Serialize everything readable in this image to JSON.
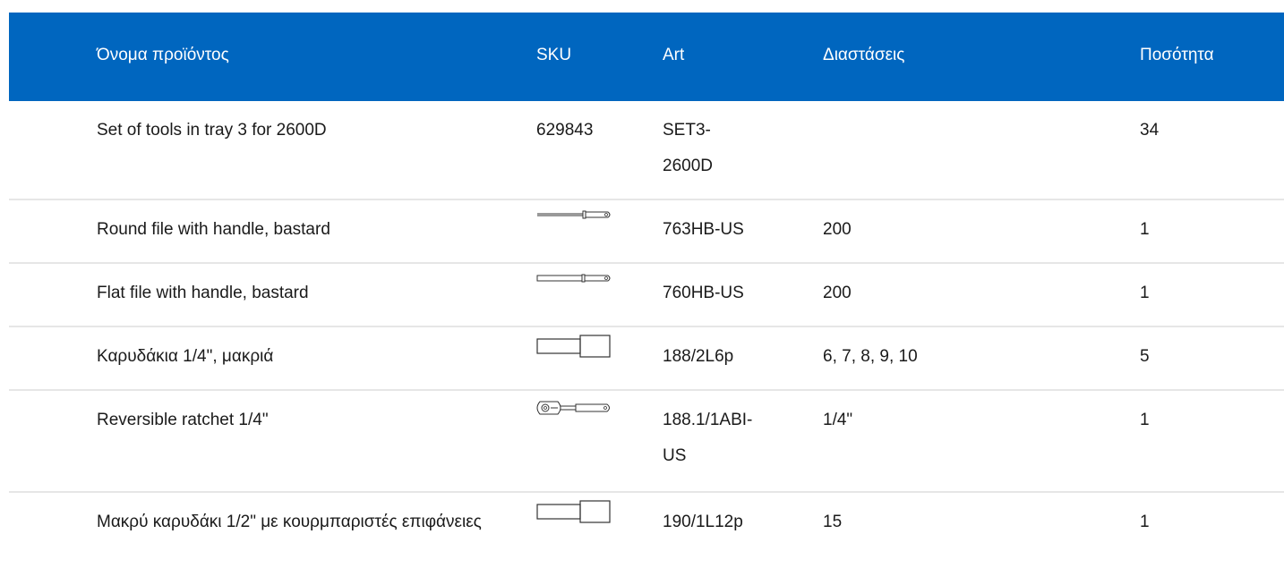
{
  "table": {
    "headers": {
      "name": "Όνομα προϊόντος",
      "sku": "SKU",
      "art": "Art",
      "dimensions": "Διαστάσεις",
      "quantity": "Ποσότητα"
    },
    "rows": [
      {
        "name": "Set of tools in tray 3 for 2600D",
        "sku": "629843",
        "art": "SET3-2600D",
        "dimensions": "",
        "quantity": "34",
        "icon": "none"
      },
      {
        "name": "Round file with handle, bastard",
        "sku": "",
        "art": "763HB-US",
        "dimensions": "200",
        "quantity": "1",
        "icon": "round-file-icon"
      },
      {
        "name": "Flat file with handle, bastard",
        "sku": "",
        "art": "760HB-US",
        "dimensions": "200",
        "quantity": "1",
        "icon": "flat-file-icon"
      },
      {
        "name": "Καρυδάκια 1/4\", μακριά",
        "sku": "",
        "art": "188/2L6p",
        "dimensions": "6, 7, 8, 9, 10",
        "quantity": "5",
        "icon": "socket-icon"
      },
      {
        "name": "Reversible ratchet 1/4\"",
        "sku": "",
        "art": "188.1/1ABI-US",
        "dimensions": "1/4\"",
        "quantity": "1",
        "icon": "ratchet-icon"
      },
      {
        "name": "Μακρύ καρυδάκι 1/2\" με κουρμπαριστές επιφάνειες",
        "sku": "",
        "art": "190/1L12p",
        "dimensions": "15",
        "quantity": "1",
        "icon": "socket-icon"
      }
    ]
  },
  "colors": {
    "header_background": "#0066bf",
    "header_text": "#ffffff",
    "row_divider": "#e6e6e6"
  }
}
